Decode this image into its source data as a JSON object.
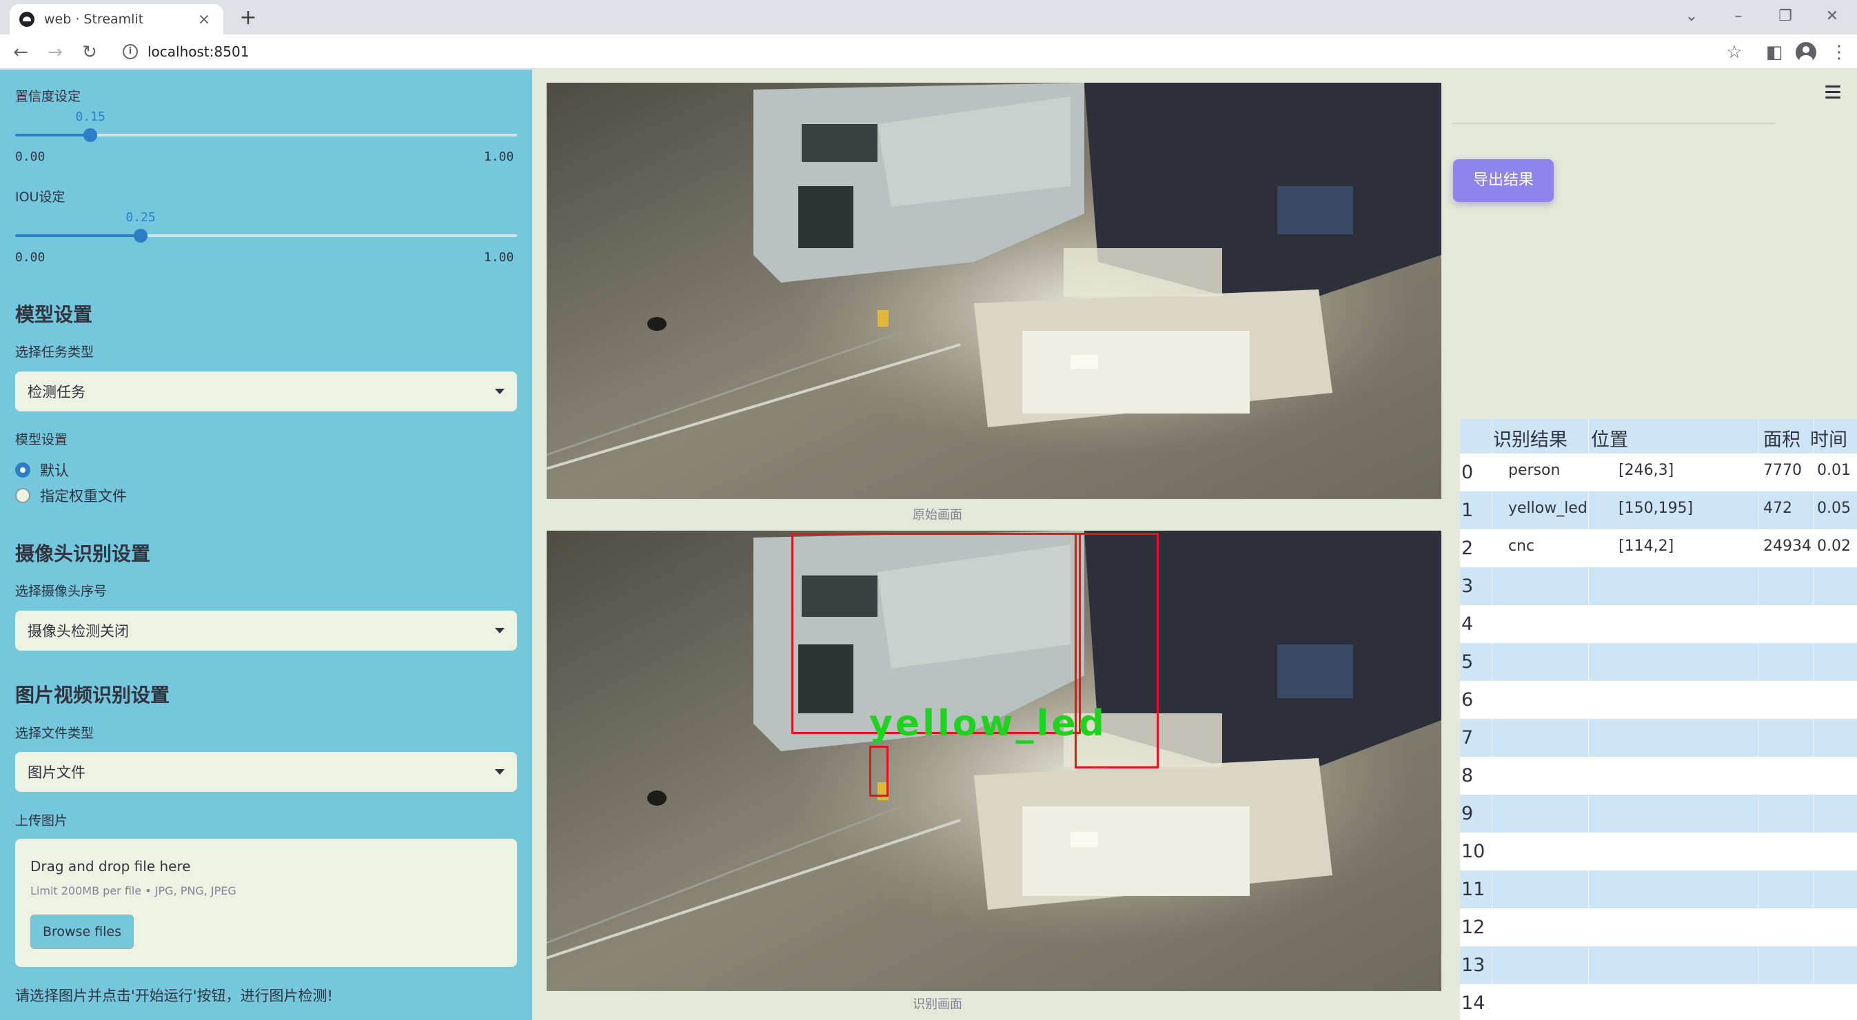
{
  "browser": {
    "tab_title": "web · Streamlit",
    "url": "localhost:8501"
  },
  "sidebar": {
    "confidence": {
      "label": "置信度设定",
      "value": "0.15",
      "min": "0.00",
      "max": "1.00",
      "fraction": 0.15
    },
    "iou": {
      "label": "IOU设定",
      "value": "0.25",
      "min": "0.00",
      "max": "1.00",
      "fraction": 0.25
    },
    "model_heading": "模型设置",
    "task_type_label": "选择任务类型",
    "task_type_value": "检测任务",
    "model_settings_label": "模型设置",
    "model_options": [
      {
        "label": "默认",
        "selected": true
      },
      {
        "label": "指定权重文件",
        "selected": false
      }
    ],
    "camera_heading": "摄像头识别设置",
    "camera_label": "选择摄像头序号",
    "camera_value": "摄像头检测关闭",
    "media_heading": "图片视频识别设置",
    "file_type_label": "选择文件类型",
    "file_type_value": "图片文件",
    "upload_label": "上传图片",
    "upload_title": "Drag and drop file here",
    "upload_hint": "Limit 200MB per file • JPG, PNG, JPEG",
    "browse_label": "Browse files",
    "footer_text": "请选择图片并点击'开始运行'按钮，进行图片检测!"
  },
  "main": {
    "original_caption": "原始画面",
    "detected_caption": "识别画面",
    "detection_label": "yellow_led"
  },
  "right": {
    "export_label": "导出结果",
    "table": {
      "headers": [
        "识别结果",
        "位置",
        "面积",
        "时间"
      ],
      "rows": [
        {
          "idx": "0",
          "result": "person",
          "position": "[246,3]",
          "area": "7770",
          "time": "0.01"
        },
        {
          "idx": "1",
          "result": "yellow_led",
          "position": "[150,195]",
          "area": "472",
          "time": "0.05"
        },
        {
          "idx": "2",
          "result": "cnc",
          "position": "[114,2]",
          "area": "24934",
          "time": "0.02"
        },
        {
          "idx": "3",
          "result": "",
          "position": "",
          "area": "",
          "time": ""
        },
        {
          "idx": "4",
          "result": "",
          "position": "",
          "area": "",
          "time": ""
        },
        {
          "idx": "5",
          "result": "",
          "position": "",
          "area": "",
          "time": ""
        },
        {
          "idx": "6",
          "result": "",
          "position": "",
          "area": "",
          "time": ""
        },
        {
          "idx": "7",
          "result": "",
          "position": "",
          "area": "",
          "time": ""
        },
        {
          "idx": "8",
          "result": "",
          "position": "",
          "area": "",
          "time": ""
        },
        {
          "idx": "9",
          "result": "",
          "position": "",
          "area": "",
          "time": ""
        },
        {
          "idx": "10",
          "result": "",
          "position": "",
          "area": "",
          "time": ""
        },
        {
          "idx": "11",
          "result": "",
          "position": "",
          "area": "",
          "time": ""
        },
        {
          "idx": "12",
          "result": "",
          "position": "",
          "area": "",
          "time": ""
        },
        {
          "idx": "13",
          "result": "",
          "position": "",
          "area": "",
          "time": ""
        },
        {
          "idx": "14",
          "result": "",
          "position": "",
          "area": "",
          "time": ""
        }
      ]
    }
  },
  "colors": {
    "sidebar_bg": "#74c7dd",
    "main_bg": "#e3e8d8",
    "accent": "#2c7fc6",
    "export_btn": "#8f84ec",
    "row_blue": "#cde5f6",
    "row_white": "#ffffff",
    "detection_box": "#e0161b",
    "detection_text": "#1fd21f"
  }
}
